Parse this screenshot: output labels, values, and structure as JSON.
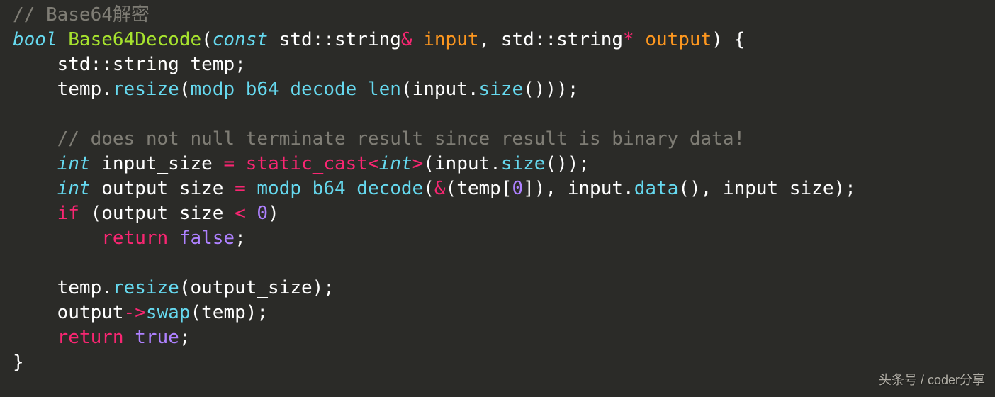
{
  "watermark": "头条号 / coder分享",
  "lines": {
    "l01": {
      "cmt": "// Base64解密"
    },
    "l02": {
      "bool": "bool",
      "sp": " ",
      "fn": "Base64Decode",
      "op1": "(",
      "const": "const",
      "sp2": " ",
      "std1": "std",
      "cc1": "::",
      "string1": "string",
      "amp": "&",
      "sp3": " ",
      "p1": "input",
      "comma": ", ",
      "std2": "std",
      "cc2": "::",
      "string2": "string",
      "star": "*",
      "sp4": " ",
      "p2": "output",
      "op2": ") {"
    },
    "l03": {
      "indent": "    ",
      "std": "std",
      "cc": "::",
      "string": "string",
      "sp": " ",
      "var": "temp",
      "end": ";"
    },
    "l04": {
      "indent": "    ",
      "v": "temp",
      "dot": ".",
      "resize": "resize",
      "op1": "(",
      "fn": "modp_b64_decode_len",
      "op2": "(",
      "inp": "input",
      "dot2": ".",
      "size": "size",
      "op3": "()));"
    },
    "l05": {
      "blank": ""
    },
    "l06": {
      "indent": "    ",
      "cmt": "// does not null terminate result since result is binary data!"
    },
    "l07": {
      "indent": "    ",
      "int": "int",
      "sp": " ",
      "v": "input_size",
      "eq": " = ",
      "sc": "static_cast",
      "lt": "<",
      "int2": "int",
      "gt": ">",
      "op1": "(",
      "inp": "input",
      "dot": ".",
      "size": "size",
      "op2": "());"
    },
    "l08": {
      "indent": "    ",
      "int": "int",
      "sp": " ",
      "v": "output_size",
      "eq": " = ",
      "fn": "modp_b64_decode",
      "op1": "(",
      "amp": "&",
      "op2": "(",
      "tmp": "temp",
      "br": "[",
      "zero": "0",
      "br2": "]), ",
      "inp": "input",
      "dot": ".",
      "data": "data",
      "op3": "(), ",
      "is": "input_size",
      "op4": ");"
    },
    "l09": {
      "indent": "    ",
      "if": "if",
      "sp": " ",
      "op1": "(",
      "v": "output_size",
      "lt": " < ",
      "zero": "0",
      "op2": ")"
    },
    "l10": {
      "indent": "        ",
      "ret": "return",
      "sp": " ",
      "false": "false",
      "end": ";"
    },
    "l11": {
      "blank": ""
    },
    "l12": {
      "indent": "    ",
      "v": "temp",
      "dot": ".",
      "resize": "resize",
      "op1": "(",
      "os": "output_size",
      "op2": ");"
    },
    "l13": {
      "indent": "    ",
      "v": "output",
      "arrow": "->",
      "swap": "swap",
      "op1": "(",
      "tmp": "temp",
      "op2": ");"
    },
    "l14": {
      "indent": "    ",
      "ret": "return",
      "sp": " ",
      "true": "true",
      "end": ";"
    },
    "l15": {
      "cb": "}"
    }
  }
}
